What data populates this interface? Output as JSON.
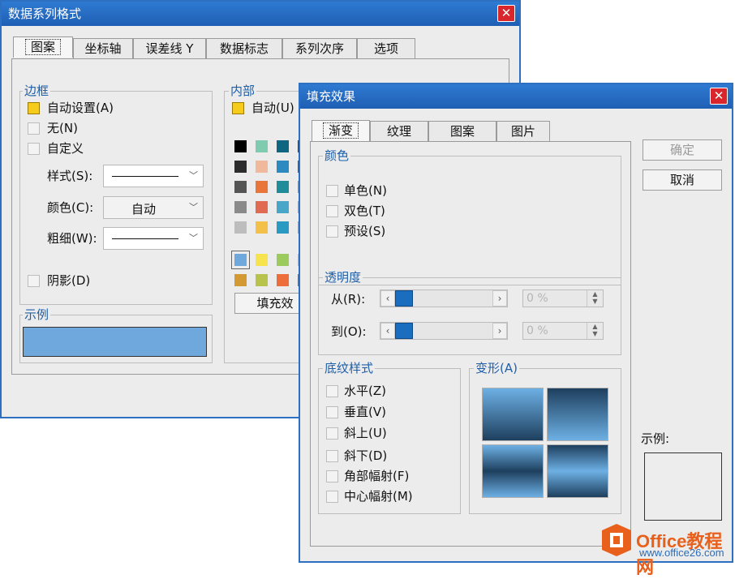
{
  "back_dialog": {
    "title": "数据系列格式",
    "close": "✕",
    "tabs": [
      "图案",
      "坐标轴",
      "误差线 Y",
      "数据标志",
      "系列次序",
      "选项"
    ],
    "border": {
      "title": "边框",
      "options": [
        "自动设置(A)",
        "无(N)",
        "自定义"
      ],
      "style_label": "样式(S):",
      "color_label": "颜色(C):",
      "color_value": "自动",
      "weight_label": "粗细(W):",
      "shadow_label": "阴影(D)"
    },
    "interior": {
      "title": "内部",
      "auto_label": "自动(U)",
      "fill_button": "填充效"
    },
    "sample": {
      "title": "示例",
      "color": "#6ea8dc"
    },
    "palette_colors": [
      [
        "#000000",
        "#7ecbb0",
        "#0f6680",
        "#1c3a7a"
      ],
      [
        "#2c2c2c",
        "#f1b99c",
        "#2c8ac0",
        "#3d6a28"
      ],
      [
        "#555555",
        "#e8763b",
        "#1f8c9a",
        "#7ab33b"
      ],
      [
        "#8a8a8a",
        "#e06a52",
        "#48a7c8",
        "#9ac14a"
      ],
      [
        "#bdbdbd",
        "#f3c14a",
        "#2a9ac3",
        "#7cc94e"
      ],
      [
        "#6ea8dc",
        "#f7e34e",
        "#9acb5c",
        "#f0a2a2"
      ],
      [
        "#d39a34",
        "#b7c34a",
        "#ee6e3b",
        "#c74a57"
      ]
    ],
    "yellow": "#f7cb1a"
  },
  "front_dialog": {
    "title": "填充效果",
    "close": "✕",
    "tabs": [
      "渐变",
      "纹理",
      "图案",
      "图片"
    ],
    "ok": "确定",
    "cancel": "取消",
    "color": {
      "title": "颜色",
      "options": [
        "单色(N)",
        "双色(T)",
        "预设(S)"
      ]
    },
    "transparency": {
      "title": "透明度",
      "from_label": "从(R):",
      "to_label": "到(O):",
      "from_value": "0 %",
      "to_value": "0 %"
    },
    "shading": {
      "title": "底纹样式",
      "options": [
        "水平(Z)",
        "垂直(V)",
        "斜上(U)",
        "斜下(D)",
        "角部幅射(F)",
        "中心幅射(M)"
      ]
    },
    "variants": {
      "title": "变形(A)"
    },
    "sample_label": "示例:"
  },
  "watermark": {
    "brand": "Office教程网",
    "url": "www.office26.com"
  },
  "colors": {
    "titlebar": "#1e5fb4",
    "accent_text": "#1f5ea8",
    "close_red": "#d9262c",
    "thumb_blue": "#1a6dbf",
    "logo_orange": "#e8601b"
  }
}
